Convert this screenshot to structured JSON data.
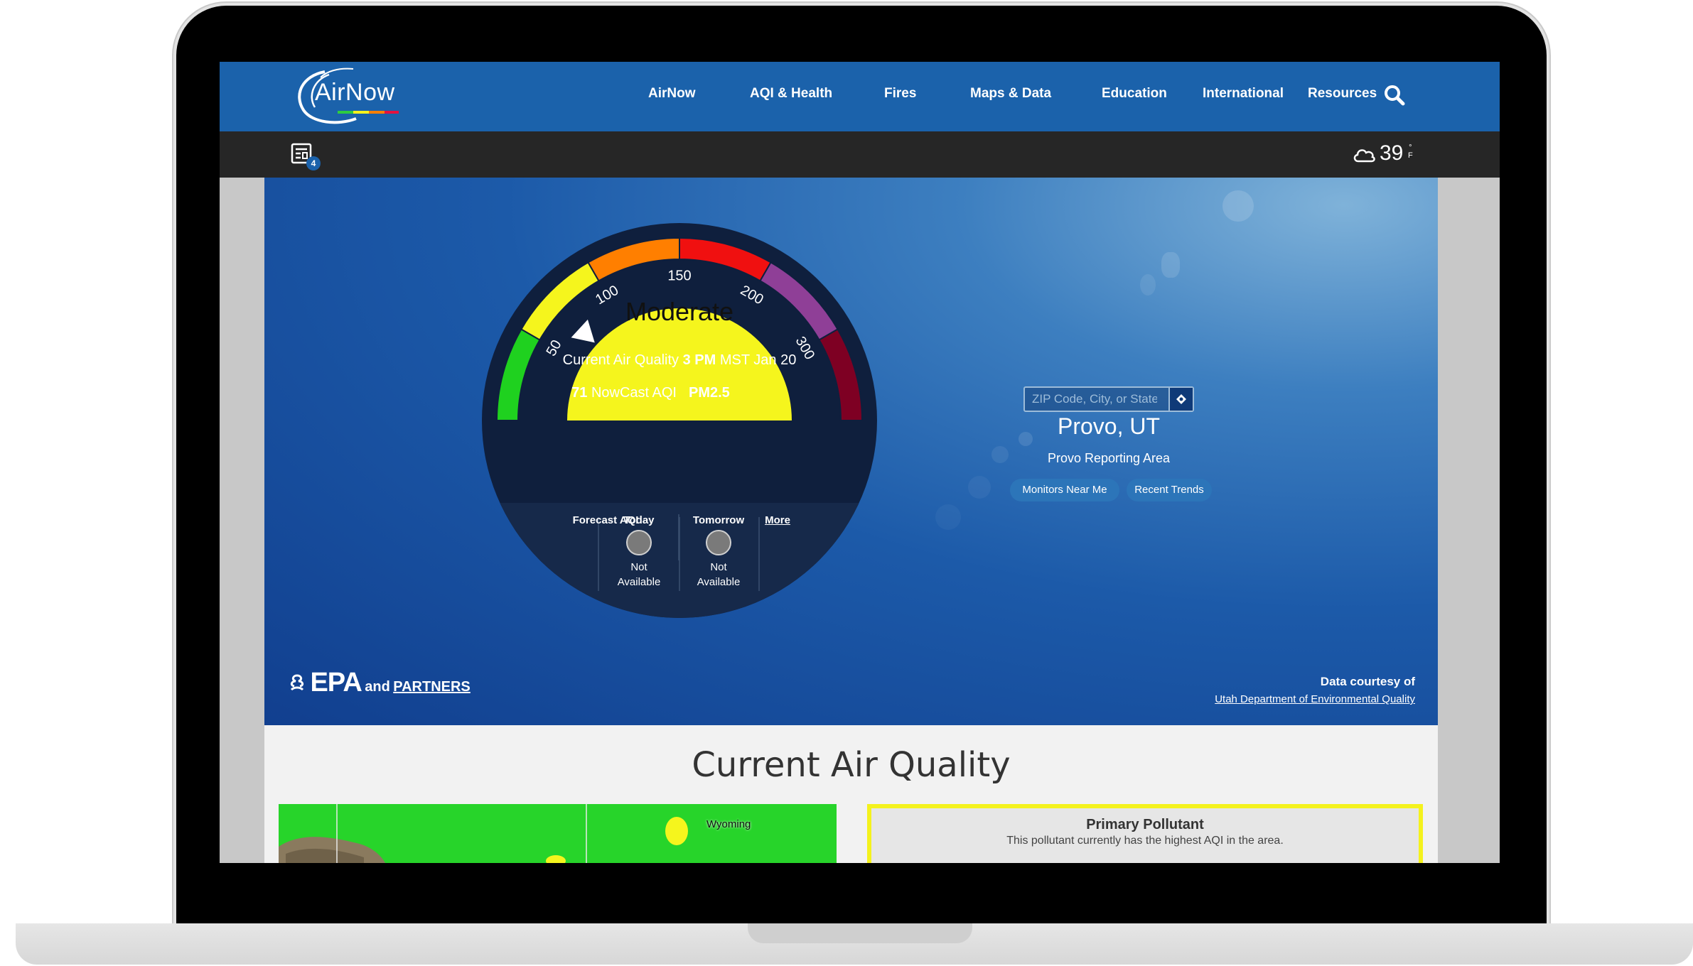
{
  "nav": {
    "logo_text": "AirNow",
    "items": [
      {
        "label": "AirNow"
      },
      {
        "label": "AQI & Health"
      },
      {
        "label": "Fires"
      },
      {
        "label": "Maps & Data"
      },
      {
        "label": "Education"
      },
      {
        "label": "International"
      },
      {
        "label": "Resources"
      }
    ],
    "search_icon": "search-icon"
  },
  "toolbar": {
    "notifications_icon": "report-list-icon",
    "notification_count": "4",
    "weather_icon": "cloud-icon",
    "temperature": "39",
    "temp_unit_symbol": "°",
    "temp_unit_letter": "F"
  },
  "gauge": {
    "category": "Moderate",
    "aqi_value": 71,
    "ticks": [
      "50",
      "100",
      "150",
      "200",
      "300"
    ],
    "colors": {
      "good": "#1fd11f",
      "moderate": "#f5f51d",
      "usg": "#ff7f00",
      "unhealthy": "#f01010",
      "very_unhealthy": "#8f3f97",
      "hazardous": "#7e0023"
    },
    "current_label": "Current Air Quality",
    "current_time": "3 PM",
    "current_date": "MST Jan 20",
    "nowcast_value": "71",
    "nowcast_label": "NowCast AQI",
    "pollutant": "PM2.5"
  },
  "forecast": {
    "label": "Forecast AQI",
    "days": [
      {
        "name": "Today",
        "status_line1": "Not",
        "status_line2": "Available"
      },
      {
        "name": "Tomorrow",
        "status_line1": "Not",
        "status_line2": "Available"
      }
    ],
    "more_label": "More"
  },
  "location": {
    "placeholder": "ZIP Code, City, or State",
    "locate_icon": "crosshair-icon",
    "city": "Provo, UT",
    "area": "Provo Reporting Area",
    "buttons": [
      {
        "label": "Monitors Near Me"
      },
      {
        "label": "Recent Trends"
      }
    ]
  },
  "footer_hero": {
    "epa_text": "EPA",
    "and_text": "and",
    "partners_link": "PARTNERS",
    "courtesy_label": "Data courtesy of",
    "courtesy_link": "Utah Department of Environmental Quality"
  },
  "lower": {
    "title": "Current Air Quality",
    "map_label": "Wyoming",
    "pollutant_title": "Primary Pollutant",
    "pollutant_desc": "This pollutant currently has the highest AQI in the area."
  }
}
